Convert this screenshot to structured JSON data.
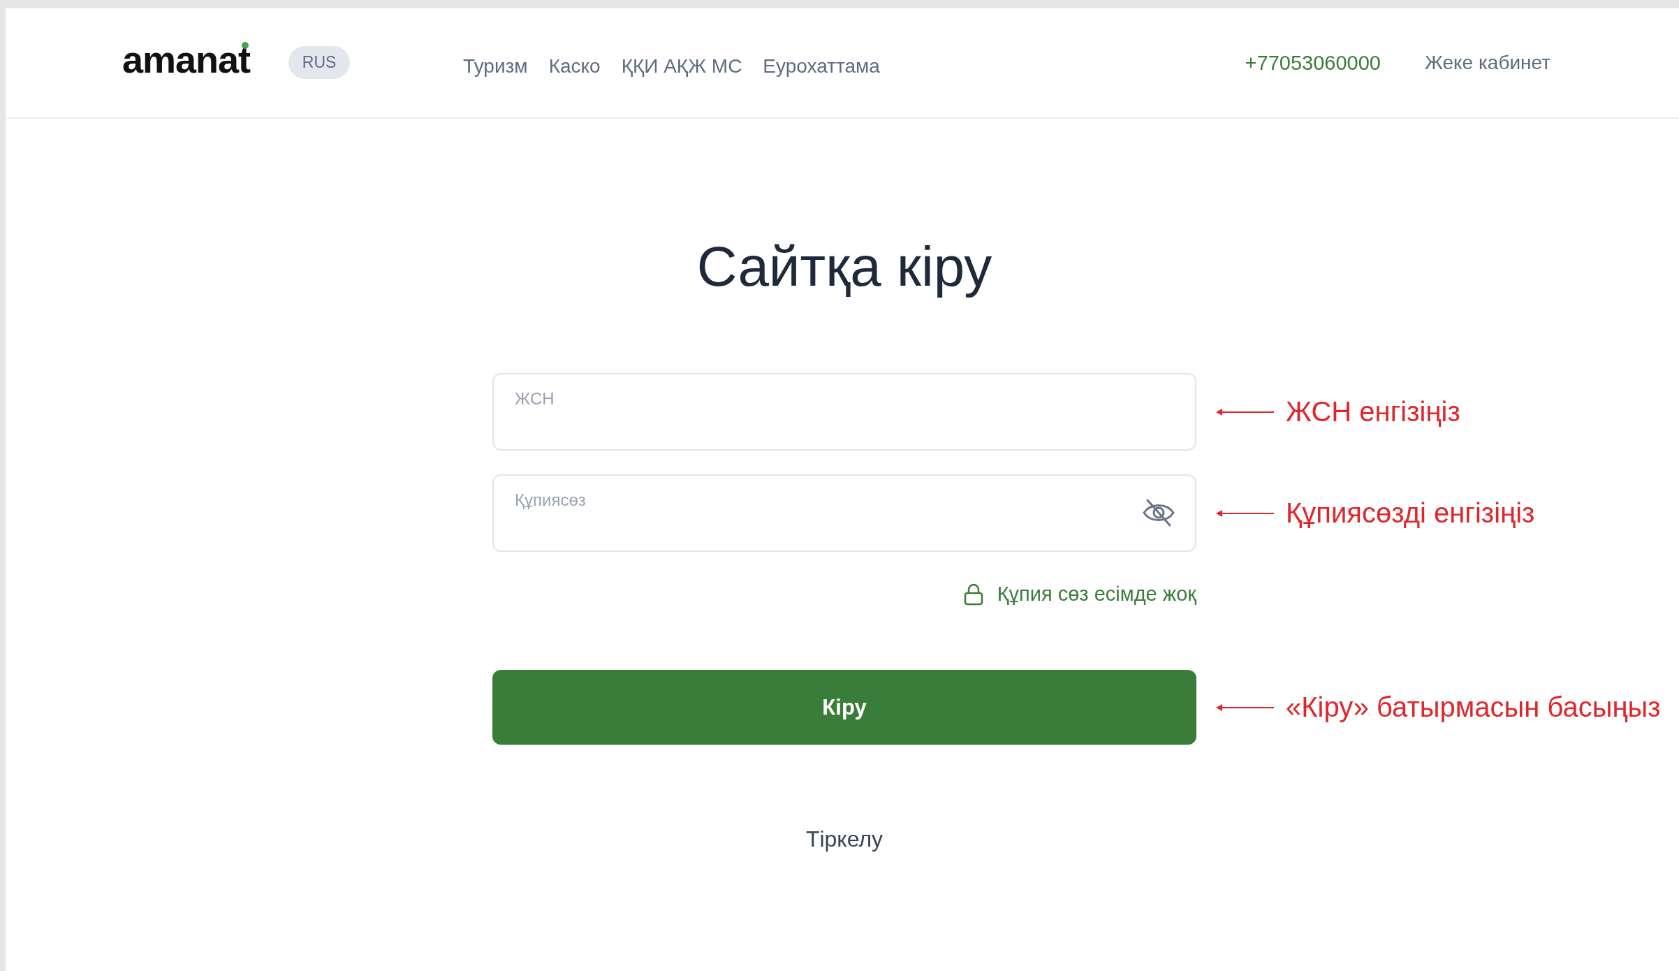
{
  "header": {
    "logo": "amanat",
    "language": "RUS",
    "nav": [
      "Туризм",
      "Каско",
      "ҚҚИ АҚЖ МС",
      "Еурохаттама"
    ],
    "phone": "+77053060000",
    "account": "Жеке кабинет"
  },
  "title": "Сайтқа кіру",
  "fields": [
    {
      "kind": "text",
      "placeholder": "ЖСН",
      "annotation": "ЖСН енгізіңіз"
    },
    {
      "kind": "password",
      "placeholder": "Құпиясөз",
      "annotation": "Құпиясөзді енгізіңіз"
    }
  ],
  "forgot_link": "Құпия сөз есімде жоқ",
  "submit": {
    "label": "Кіру",
    "annotation": "«Кіру» батырмасын басыңыз"
  },
  "register_link": "Тіркелу"
}
